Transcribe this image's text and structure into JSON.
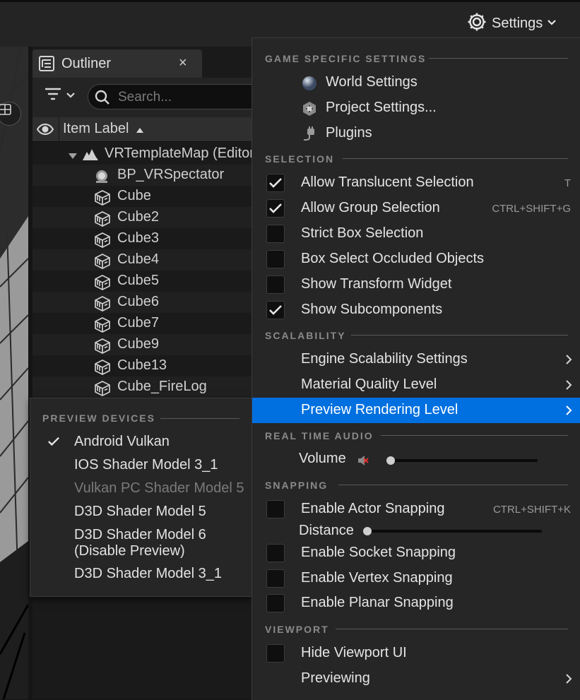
{
  "toolbar": {
    "settings_label": "Settings"
  },
  "outliner": {
    "tab_title": "Outliner",
    "close_glyph": "×",
    "search_placeholder": "Search...",
    "column_label": "Item Label",
    "rows": [
      {
        "label": "VRTemplateMap (Editor)",
        "icon": "level-icon"
      },
      {
        "label": "BP_VRSpectator",
        "icon": "spectator-icon"
      },
      {
        "label": "Cube",
        "icon": "cube-icon"
      },
      {
        "label": "Cube2",
        "icon": "cube-icon"
      },
      {
        "label": "Cube3",
        "icon": "cube-icon"
      },
      {
        "label": "Cube4",
        "icon": "cube-icon"
      },
      {
        "label": "Cube5",
        "icon": "cube-icon"
      },
      {
        "label": "Cube6",
        "icon": "cube-icon"
      },
      {
        "label": "Cube7",
        "icon": "cube-icon"
      },
      {
        "label": "Cube9",
        "icon": "cube-icon"
      },
      {
        "label": "Cube13",
        "icon": "cube-icon"
      },
      {
        "label": "Cube_FireLog",
        "icon": "cube-icon"
      }
    ]
  },
  "preview_devices": {
    "section": "PREVIEW DEVICES",
    "items": [
      {
        "label": "Android Vulkan",
        "checked": true,
        "disabled": false
      },
      {
        "label": "IOS Shader Model 3_1",
        "checked": false,
        "disabled": false
      },
      {
        "label": "Vulkan PC Shader Model 5",
        "checked": false,
        "disabled": true
      },
      {
        "label": "D3D Shader Model 5",
        "checked": false,
        "disabled": false
      },
      {
        "label": "D3D Shader Model 6\n(Disable Preview)",
        "checked": false,
        "disabled": false
      },
      {
        "label": "D3D Shader Model 3_1",
        "checked": false,
        "disabled": false
      }
    ]
  },
  "settings_menu": {
    "game_specific": {
      "section": "GAME SPECIFIC SETTINGS",
      "world_settings": "World Settings",
      "project_settings": "Project Settings...",
      "plugins": "Plugins"
    },
    "selection": {
      "section": "SELECTION",
      "items": [
        {
          "label": "Allow Translucent Selection",
          "checked": true,
          "shortcut": "T"
        },
        {
          "label": "Allow Group Selection",
          "checked": true,
          "shortcut": "CTRL+SHIFT+G"
        },
        {
          "label": "Strict Box Selection",
          "checked": false,
          "shortcut": ""
        },
        {
          "label": "Box Select Occluded Objects",
          "checked": false,
          "shortcut": ""
        },
        {
          "label": "Show Transform Widget",
          "checked": false,
          "shortcut": ""
        },
        {
          "label": "Show Subcomponents",
          "checked": true,
          "shortcut": ""
        }
      ]
    },
    "scalability": {
      "section": "SCALABILITY",
      "engine_scalability": "Engine Scalability Settings",
      "material_quality": "Material Quality Level",
      "preview_rendering": "Preview Rendering Level"
    },
    "audio": {
      "section": "REAL TIME AUDIO",
      "volume_label": "Volume",
      "volume_value": 0.0
    },
    "snapping": {
      "section": "SNAPPING",
      "actor_snapping": "Enable Actor Snapping",
      "actor_snapping_checked": false,
      "actor_snapping_shortcut": "CTRL+SHIFT+K",
      "distance_label": "Distance",
      "distance_value": 0.0,
      "socket_snapping": "Enable Socket Snapping",
      "vertex_snapping": "Enable Vertex Snapping",
      "planar_snapping": "Enable Planar Snapping"
    },
    "viewport": {
      "section": "VIEWPORT",
      "hide_viewport_ui": "Hide Viewport UI",
      "hide_viewport_ui_checked": false,
      "previewing": "Previewing"
    }
  },
  "colors": {
    "highlight": "#0070e0",
    "menu_bg": "#262626",
    "section_text": "#8a8a8a"
  }
}
